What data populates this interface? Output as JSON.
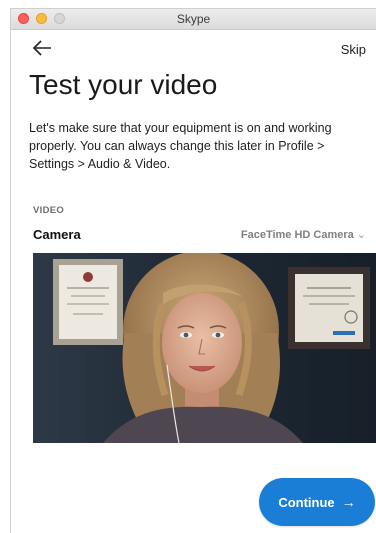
{
  "window": {
    "title": "Skype"
  },
  "nav": {
    "back_icon": "arrow-left-icon",
    "skip_label": "Skip"
  },
  "page": {
    "heading": "Test your video",
    "description": "Let's make sure that your equipment is on and working properly. You can always change this later in Profile > Settings > Audio & Video."
  },
  "video_section": {
    "section_label": "VIDEO",
    "camera_label": "Camera",
    "camera_selected": "FaceTime HD Camera",
    "chevron": "⌄"
  },
  "actions": {
    "continue_label": "Continue",
    "continue_arrow": "→"
  },
  "colors": {
    "accent": "#1b7ed6",
    "close": "#fc605c",
    "minimize": "#fdbc40"
  }
}
